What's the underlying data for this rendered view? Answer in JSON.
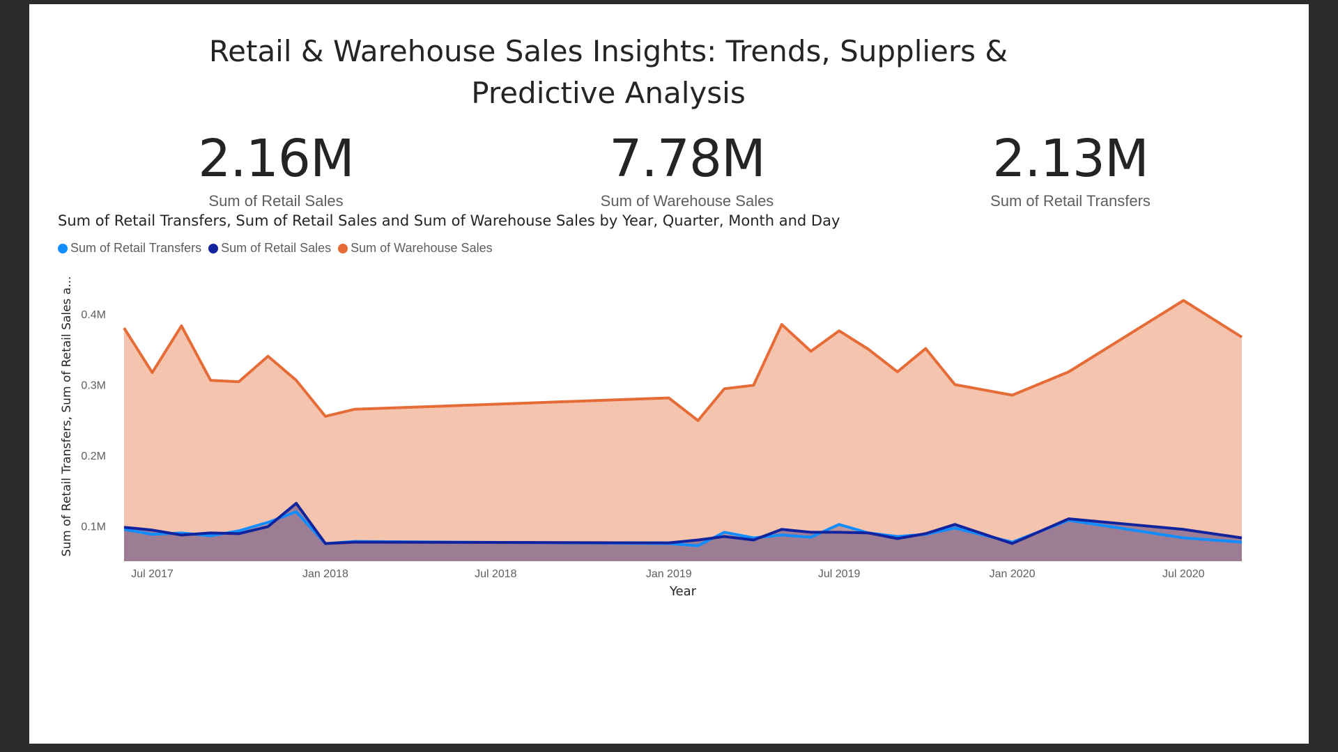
{
  "page": {
    "title": "Retail & Warehouse Sales Insights: Trends, Suppliers & Predictive Analysis"
  },
  "cards": [
    {
      "value": "2.16M",
      "label": "Sum of Retail Sales"
    },
    {
      "value": "7.78M",
      "label": "Sum of Warehouse Sales"
    },
    {
      "value": "2.13M",
      "label": "Sum of Retail Transfers"
    }
  ],
  "colors": {
    "retail_transfers": "#118dff",
    "retail_sales": "#12239e",
    "warehouse_sales": "#e66c37",
    "warehouse_fill": "#f4c4ae",
    "retail_fill": "#9c7d95"
  },
  "chart_data": {
    "type": "area",
    "title": "Sum of Retail Transfers, Sum of Retail Sales and Sum of Warehouse Sales by Year, Quarter, Month and Day",
    "xlabel": "Year",
    "ylabel": "Sum of Retail Transfers, Sum of Retail Sales a...",
    "ylim": [
      0.05,
      0.45
    ],
    "yticks": [
      {
        "value": 0.1,
        "label": "0.1M"
      },
      {
        "value": 0.2,
        "label": "0.2M"
      },
      {
        "value": 0.3,
        "label": "0.3M"
      },
      {
        "value": 0.4,
        "label": "0.4M"
      }
    ],
    "xlim": [
      "2017-06-01",
      "2020-09-01"
    ],
    "xticks": [
      {
        "date": "2017-07-01",
        "label": "Jul 2017"
      },
      {
        "date": "2018-01-01",
        "label": "Jan 2018"
      },
      {
        "date": "2018-07-01",
        "label": "Jul 2018"
      },
      {
        "date": "2019-01-01",
        "label": "Jan 2019"
      },
      {
        "date": "2019-07-01",
        "label": "Jul 2019"
      },
      {
        "date": "2020-01-01",
        "label": "Jan 2020"
      },
      {
        "date": "2020-07-01",
        "label": "Jul 2020"
      }
    ],
    "legend_position": "top-left",
    "grid": false,
    "x": [
      "2017-06-01",
      "2017-07-01",
      "2017-08-01",
      "2017-09-01",
      "2017-10-01",
      "2017-11-01",
      "2017-12-01",
      "2018-01-01",
      "2018-02-01",
      "2019-01-01",
      "2019-02-01",
      "2019-03-01",
      "2019-04-01",
      "2019-05-01",
      "2019-06-01",
      "2019-07-01",
      "2019-08-01",
      "2019-09-01",
      "2019-10-01",
      "2019-11-01",
      "2020-01-01",
      "2020-03-01",
      "2020-07-01",
      "2020-09-01"
    ],
    "series": [
      {
        "name": "Sum of Retail Transfers",
        "key": "retail_transfers",
        "values": [
          0.095,
          0.088,
          0.09,
          0.086,
          0.093,
          0.105,
          0.12,
          0.075,
          0.078,
          0.075,
          0.072,
          0.091,
          0.083,
          0.087,
          0.084,
          0.102,
          0.09,
          0.085,
          0.088,
          0.097,
          0.077,
          0.108,
          0.083,
          0.077
        ]
      },
      {
        "name": "Sum of Retail Sales",
        "key": "retail_sales",
        "values": [
          0.098,
          0.094,
          0.087,
          0.09,
          0.089,
          0.099,
          0.132,
          0.075,
          0.077,
          0.076,
          0.08,
          0.085,
          0.08,
          0.095,
          0.091,
          0.091,
          0.09,
          0.082,
          0.089,
          0.102,
          0.075,
          0.11,
          0.095,
          0.083
        ]
      },
      {
        "name": "Sum of Warehouse Sales",
        "key": "warehouse_sales",
        "values": [
          0.38,
          0.317,
          0.383,
          0.306,
          0.304,
          0.34,
          0.306,
          0.255,
          0.265,
          0.281,
          0.249,
          0.294,
          0.299,
          0.385,
          0.347,
          0.376,
          0.35,
          0.318,
          0.351,
          0.3,
          0.285,
          0.318,
          0.419,
          0.367
        ]
      }
    ]
  }
}
